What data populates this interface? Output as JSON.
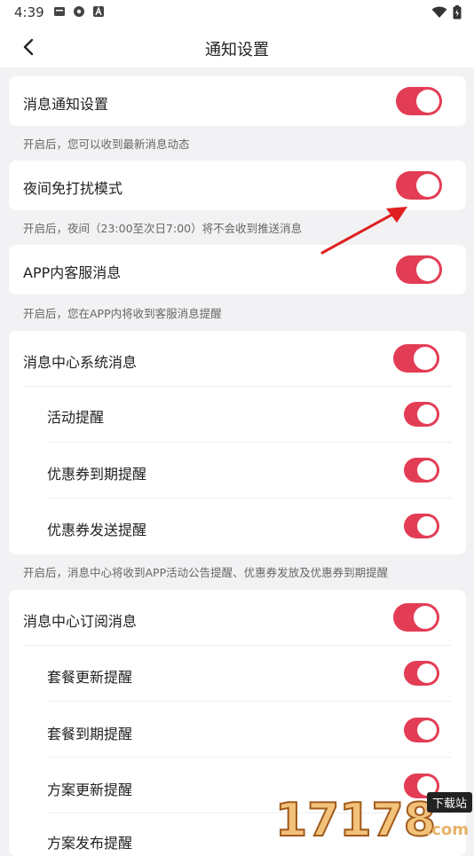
{
  "status_bar": {
    "time": "4:39",
    "icons": [
      "message-icon",
      "aperture-icon",
      "a-icon",
      "wifi-icon",
      "battery-icon"
    ]
  },
  "header": {
    "title": "通知设置",
    "back_icon": "chevron-left-icon"
  },
  "sections": {
    "message_notify": {
      "label": "消息通知设置",
      "enabled": true,
      "hint": "开启后，您可以收到最新消息动态"
    },
    "night_mode": {
      "label": "夜间免打扰模式",
      "enabled": true,
      "hint": "开启后，夜间（23:00至次日7:00）将不会收到推送消息"
    },
    "customer_service": {
      "label": "APP内客服消息",
      "enabled": true,
      "hint": "开启后，您在APP内将收到客服消息提醒"
    },
    "system_messages": {
      "label": "消息中心系统消息",
      "enabled": true,
      "items": [
        {
          "label": "活动提醒",
          "enabled": true
        },
        {
          "label": "优惠券到期提醒",
          "enabled": true
        },
        {
          "label": "优惠券发送提醒",
          "enabled": true
        }
      ],
      "hint": "开启后，消息中心将收到APP活动公告提醒、优惠券发放及优惠券到期提醒"
    },
    "subscription_messages": {
      "label": "消息中心订阅消息",
      "enabled": true,
      "items": [
        {
          "label": "套餐更新提醒",
          "enabled": true
        },
        {
          "label": "套餐到期提醒",
          "enabled": true
        },
        {
          "label": "方案更新提醒",
          "enabled": true
        },
        {
          "label": "方案发布提醒",
          "enabled": true
        }
      ]
    }
  },
  "watermark": {
    "number": "17178",
    "badge": "下载站",
    "suffix": ".com"
  },
  "colors": {
    "toggle_on": "#e33d55",
    "annotation_arrow": "#e02020"
  }
}
